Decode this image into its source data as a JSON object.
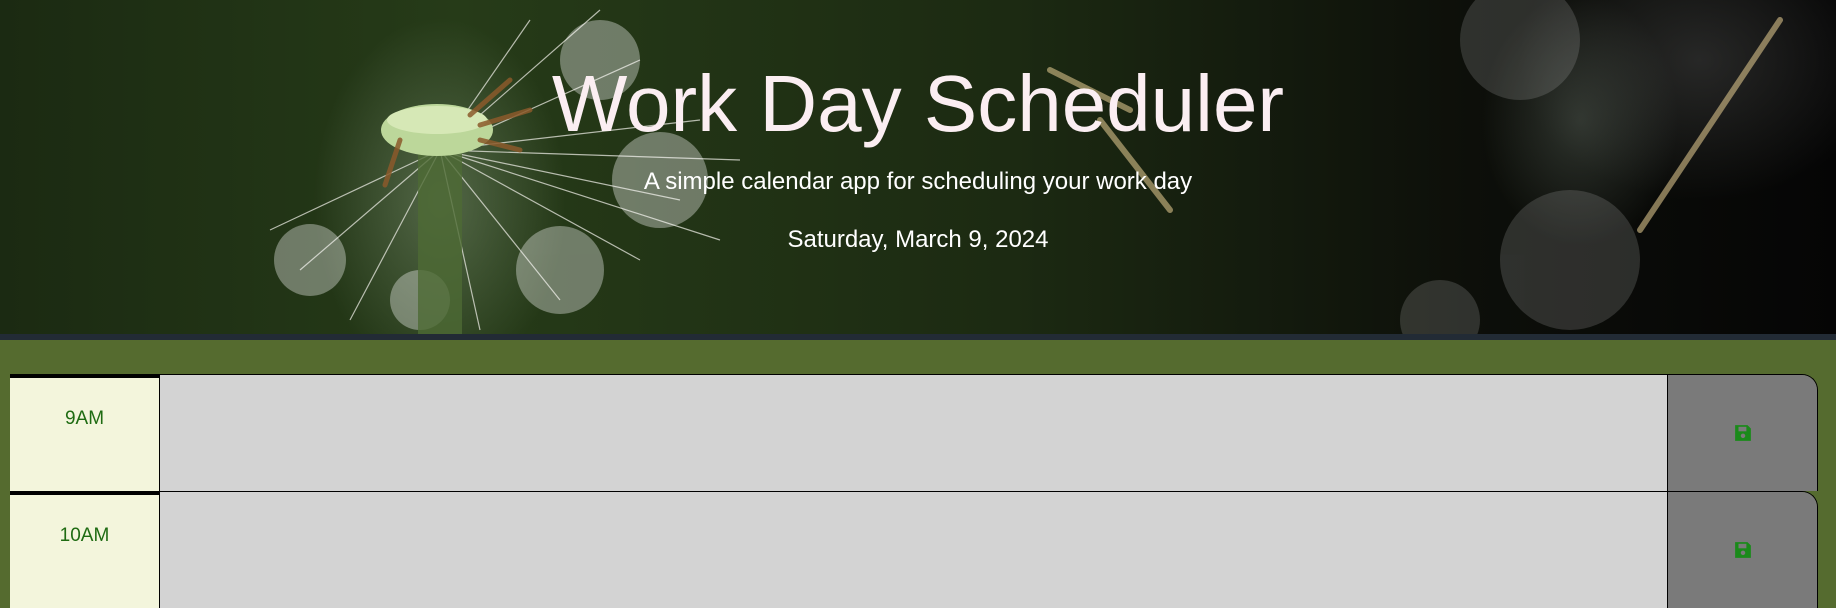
{
  "header": {
    "title": "Work Day Scheduler",
    "subtitle": "A simple calendar app for scheduling your work day",
    "current_day": "Saturday, March 9, 2024"
  },
  "colors": {
    "page_background": "#556b2f",
    "hour_background": "#f3f5dc",
    "hour_text": "#1e6b12",
    "past_block": "#d3d3d3",
    "save_button": "#7a7a7a",
    "save_icon": "#1a8a1a"
  },
  "time_blocks": [
    {
      "hour": "9AM",
      "description": "",
      "save_icon": "floppy-disk-icon"
    },
    {
      "hour": "10AM",
      "description": "",
      "save_icon": "floppy-disk-icon"
    }
  ]
}
